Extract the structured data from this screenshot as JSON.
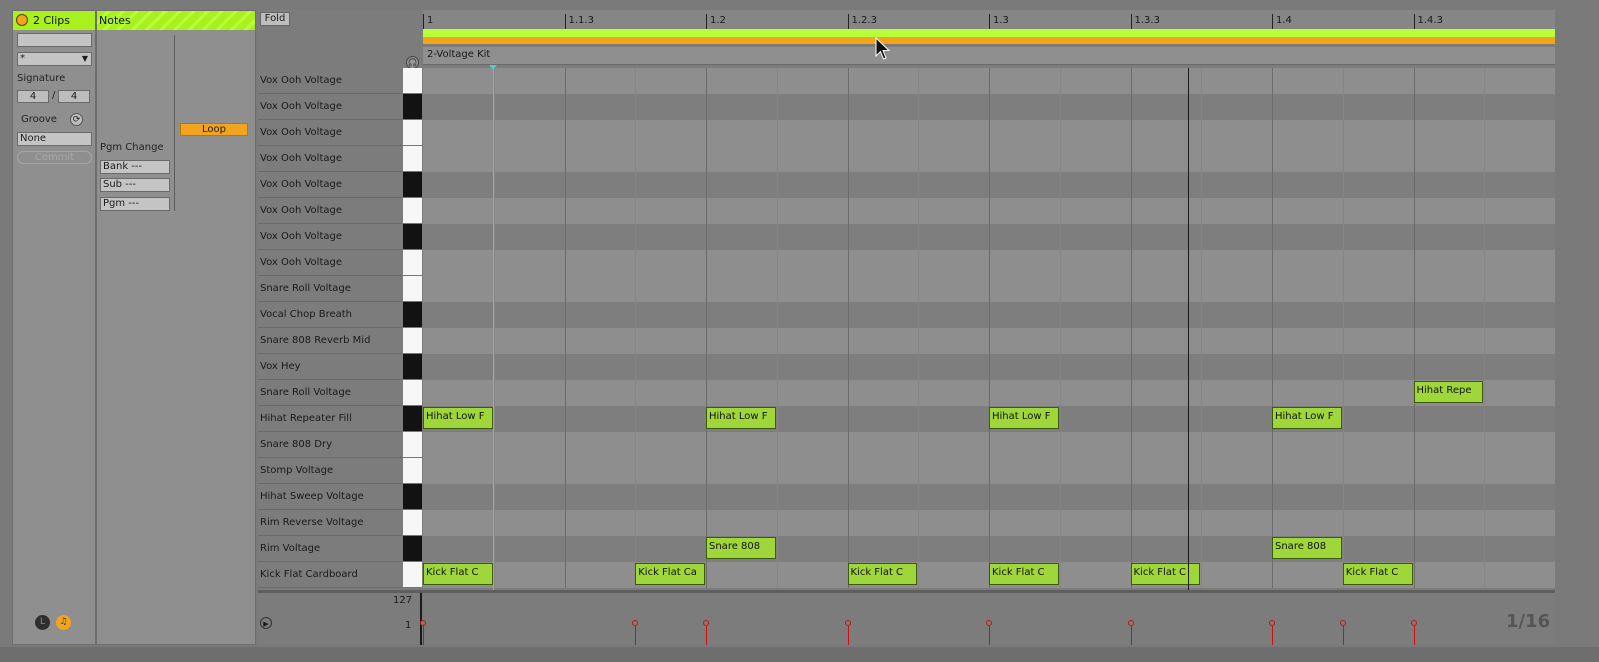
{
  "clip_panel": {
    "title": "2 Clips",
    "name_field": "",
    "dropdown_value": "*",
    "signature_label": "Signature",
    "signature_numerator": "4",
    "signature_denominator": "4",
    "signature_separator": "/",
    "groove_label": "Groove",
    "groove_value": "None",
    "commit_label": "Commit",
    "footer_left_icon": "L",
    "footer_right_icon": "♫"
  },
  "notes_panel": {
    "title": "Notes",
    "loop_label": "Loop",
    "pgm_change_label": "Pgm Change",
    "bank_field": "Bank ---",
    "sub_field": "Sub ---",
    "pgm_field": "Pgm ---"
  },
  "editor": {
    "fold_label": "Fold",
    "clip_name": "2-Voltage Kit",
    "ruler": [
      "1",
      "1.1.3",
      "1.2",
      "1.2.3",
      "1.3",
      "1.3.3",
      "1.4",
      "1.4.3"
    ],
    "rows": [
      {
        "name": "Vox Ooh Voltage",
        "key": "white"
      },
      {
        "name": "Vox Ooh Voltage",
        "key": "black"
      },
      {
        "name": "Vox Ooh Voltage",
        "key": "white"
      },
      {
        "name": "Vox Ooh Voltage",
        "key": "white"
      },
      {
        "name": "Vox Ooh Voltage",
        "key": "black"
      },
      {
        "name": "Vox Ooh Voltage",
        "key": "white"
      },
      {
        "name": "Vox Ooh Voltage",
        "key": "black"
      },
      {
        "name": "Vox Ooh Voltage",
        "key": "white"
      },
      {
        "name": "Snare Roll Voltage",
        "key": "white"
      },
      {
        "name": "Vocal Chop Breath",
        "key": "black"
      },
      {
        "name": "Snare 808 Reverb Mid",
        "key": "white"
      },
      {
        "name": "Vox Hey",
        "key": "black"
      },
      {
        "name": "Snare Roll Voltage",
        "key": "white"
      },
      {
        "name": "Hihat Repeater Fill",
        "key": "black"
      },
      {
        "name": "Snare 808 Dry",
        "key": "white"
      },
      {
        "name": "Stomp Voltage",
        "key": "white"
      },
      {
        "name": "Hihat Sweep Voltage",
        "key": "black"
      },
      {
        "name": "Rim Reverse Voltage",
        "key": "white"
      },
      {
        "name": "Rim Voltage",
        "key": "black"
      },
      {
        "name": "Kick Flat Cardboard",
        "key": "white"
      }
    ],
    "notes": [
      {
        "row": 12,
        "start": 7.0,
        "length": 0.5,
        "label": "Hihat Repe"
      },
      {
        "row": 13,
        "start": 0.0,
        "length": 0.5,
        "label": "Hihat Low F"
      },
      {
        "row": 13,
        "start": 2.0,
        "length": 0.5,
        "label": "Hihat Low F"
      },
      {
        "row": 13,
        "start": 4.0,
        "length": 0.5,
        "label": "Hihat Low F"
      },
      {
        "row": 13,
        "start": 6.0,
        "length": 0.5,
        "label": "Hihat Low F"
      },
      {
        "row": 18,
        "start": 2.0,
        "length": 0.5,
        "label": "Snare 808"
      },
      {
        "row": 18,
        "start": 6.0,
        "length": 0.5,
        "label": "Snare 808"
      },
      {
        "row": 19,
        "start": 0.0,
        "length": 0.5,
        "label": "Kick Flat C"
      },
      {
        "row": 19,
        "start": 1.5,
        "length": 0.5,
        "label": "Kick Flat Ca"
      },
      {
        "row": 19,
        "start": 3.0,
        "length": 0.5,
        "label": "Kick Flat C"
      },
      {
        "row": 19,
        "start": 4.0,
        "length": 0.5,
        "label": "Kick Flat C"
      },
      {
        "row": 19,
        "start": 5.0,
        "length": 0.5,
        "label": "Kick Flat C"
      },
      {
        "row": 19,
        "start": 6.5,
        "length": 0.5,
        "label": "Kick Flat C"
      }
    ],
    "velocity_max": "127",
    "velocity_min": "1",
    "grid_label": "1/16",
    "colors": {
      "note": "#9fd63a",
      "header": "#a8f01e",
      "loop": "#f2a41c",
      "velocity": "#cf1010",
      "cursor_line": "#4fc8d8"
    }
  }
}
